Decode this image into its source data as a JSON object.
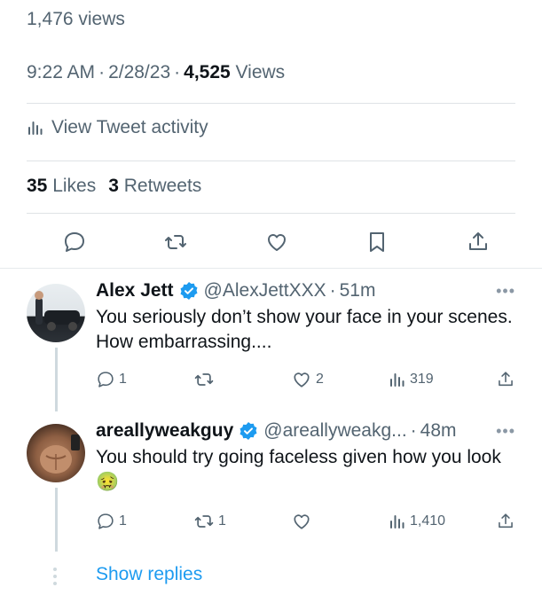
{
  "tweet": {
    "views_count_text": "1,476 views",
    "time": "9:22 AM",
    "date": "2/28/23",
    "views_number": "4,525",
    "views_label": "Views",
    "activity_label": "View Tweet activity",
    "likes_number": "35",
    "likes_label": "Likes",
    "retweets_number": "3",
    "retweets_label": "Retweets",
    "actions": [
      "reply-icon",
      "retweet-icon",
      "like-icon",
      "bookmark-icon",
      "share-icon"
    ]
  },
  "replies": [
    {
      "name": "Alex Jett",
      "handle": "@AlexJettXXX",
      "time": "51m",
      "text": "You seriously don’t show your face in your scenes. How embarrassing....",
      "reply_count": "1",
      "retweet_count": "",
      "like_count": "2",
      "view_count": "319"
    },
    {
      "name": "areallyweakguy",
      "handle": "@areallyweakg...",
      "time": "48m",
      "text": "You should try going faceless given how you look",
      "emoji": "🤢",
      "reply_count": "1",
      "retweet_count": "1",
      "like_count": "",
      "view_count": "1,410"
    }
  ],
  "show_replies_label": "Show replies",
  "colors": {
    "accent": "#1d9bf0",
    "muted": "#536471",
    "divider": "#dfe3e6"
  }
}
